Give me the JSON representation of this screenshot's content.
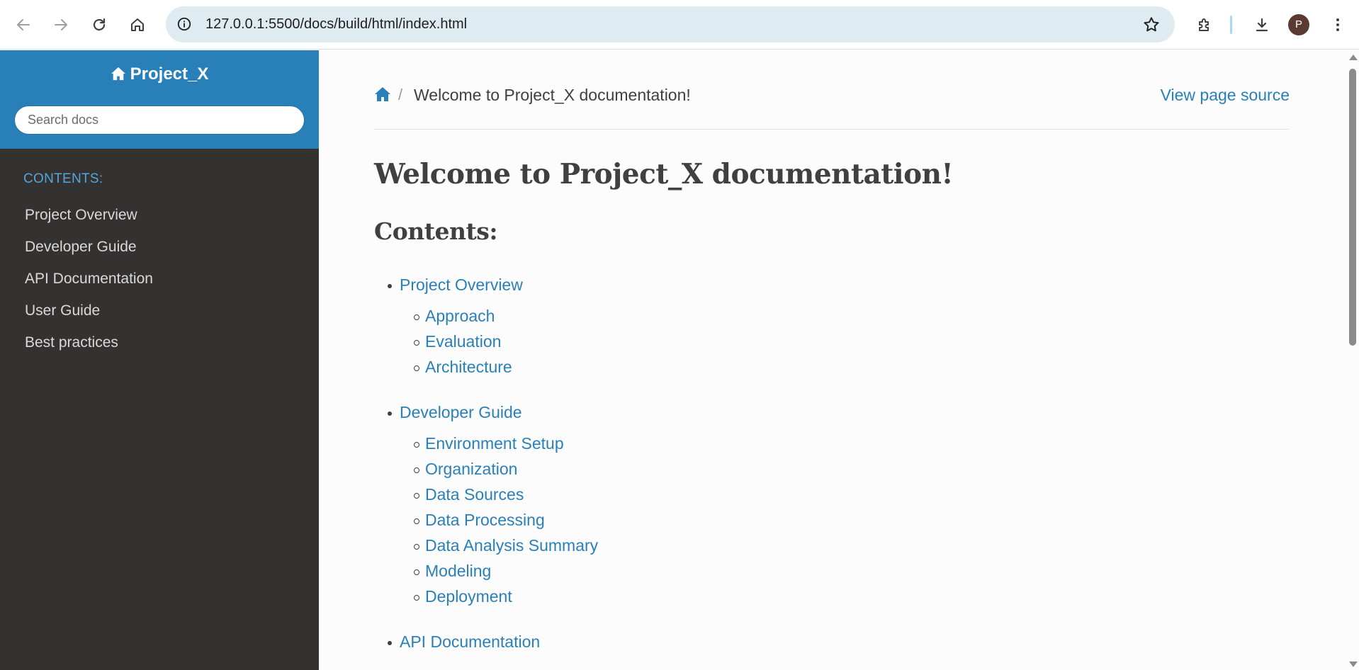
{
  "browser": {
    "url": "127.0.0.1:5500/docs/build/html/index.html",
    "profile_initial": "P",
    "icons": [
      "back-icon",
      "forward-icon",
      "reload-icon",
      "home-icon",
      "site-info-icon",
      "bookmark-star-icon",
      "extensions-icon",
      "download-icon",
      "more-menu-icon"
    ]
  },
  "sidebar": {
    "project_name": "Project_X",
    "search_placeholder": "Search docs",
    "caption": "CONTENTS:",
    "items": [
      {
        "label": "Project Overview"
      },
      {
        "label": "Developer Guide"
      },
      {
        "label": "API Documentation"
      },
      {
        "label": "User Guide"
      },
      {
        "label": "Best practices"
      }
    ]
  },
  "main": {
    "breadcrumb_current": "Welcome to Project_X documentation!",
    "breadcrumb_separator": "/",
    "view_source": "View page source",
    "title": "Welcome to Project_X documentation!",
    "contents_heading": "Contents:",
    "toc": [
      {
        "label": "Project Overview",
        "children": [
          "Approach",
          "Evaluation",
          "Architecture"
        ]
      },
      {
        "label": "Developer Guide",
        "children": [
          "Environment Setup",
          "Organization",
          "Data Sources",
          "Data Processing",
          "Data Analysis Summary",
          "Modeling",
          "Deployment"
        ]
      },
      {
        "label": "API Documentation",
        "children": []
      }
    ]
  },
  "colors": {
    "accent": "#2980b9",
    "sidebar_bg": "#343131",
    "caption": "#55a5d9",
    "address_bar": "#deebf0"
  }
}
